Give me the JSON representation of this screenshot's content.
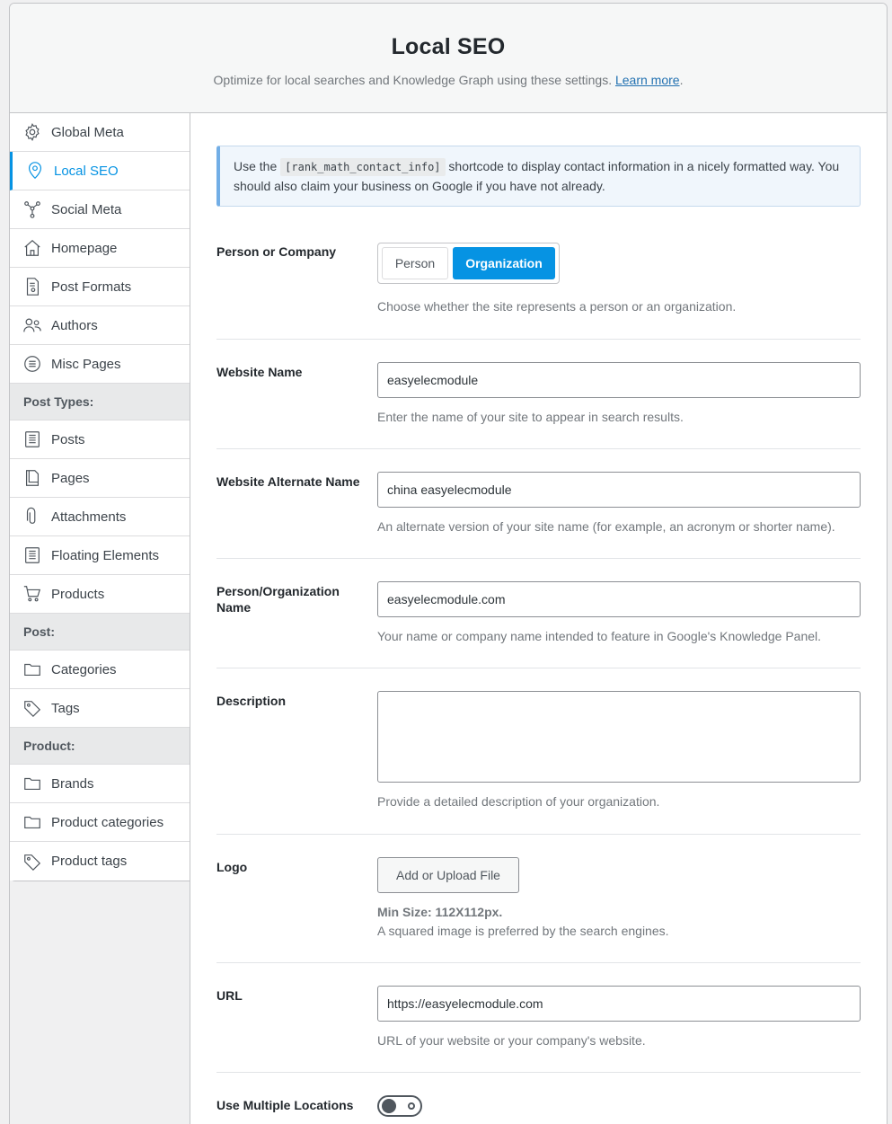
{
  "header": {
    "title": "Local SEO",
    "subtitle": "Optimize for local searches and Knowledge Graph using these settings.",
    "learn_more": "Learn more",
    "period": "."
  },
  "sidebar": {
    "items": [
      {
        "label": "Global Meta",
        "icon": "gear-icon"
      },
      {
        "label": "Local SEO",
        "icon": "location-pin-icon",
        "active": true
      },
      {
        "label": "Social Meta",
        "icon": "share-nodes-icon"
      },
      {
        "label": "Homepage",
        "icon": "home-icon"
      },
      {
        "label": "Post Formats",
        "icon": "post-format-icon"
      },
      {
        "label": "Authors",
        "icon": "users-icon"
      },
      {
        "label": "Misc Pages",
        "icon": "list-circle-icon"
      }
    ],
    "group_post_types": "Post Types:",
    "post_types": [
      {
        "label": "Posts",
        "icon": "document-icon"
      },
      {
        "label": "Pages",
        "icon": "pages-icon"
      },
      {
        "label": "Attachments",
        "icon": "paperclip-icon"
      },
      {
        "label": "Floating Elements",
        "icon": "document-icon"
      },
      {
        "label": "Products",
        "icon": "cart-icon"
      }
    ],
    "group_post": "Post:",
    "post": [
      {
        "label": "Categories",
        "icon": "folder-icon"
      },
      {
        "label": "Tags",
        "icon": "tag-icon"
      }
    ],
    "group_product": "Product:",
    "product": [
      {
        "label": "Brands",
        "icon": "folder-icon"
      },
      {
        "label": "Product categories",
        "icon": "folder-icon"
      },
      {
        "label": "Product tags",
        "icon": "tag-icon"
      }
    ]
  },
  "notice": {
    "before": "Use the ",
    "code": "[rank_math_contact_info]",
    "after": " shortcode to display contact information in a nicely formatted way. You should also claim your business on Google if you have not already."
  },
  "fields": {
    "person_company": {
      "label": "Person or Company",
      "option_person": "Person",
      "option_org": "Organization",
      "selected": "Organization",
      "desc": "Choose whether the site represents a person or an organization."
    },
    "website_name": {
      "label": "Website Name",
      "value": "easyelecmodule",
      "desc": "Enter the name of your site to appear in search results."
    },
    "alt_name": {
      "label": "Website Alternate Name",
      "value": "china easyelecmodule",
      "desc": "An alternate version of your site name (for example, an acronym or shorter name)."
    },
    "org_name": {
      "label": "Person/Organization Name",
      "value": "easyelecmodule.com",
      "desc": "Your name or company name intended to feature in Google's Knowledge Panel."
    },
    "description": {
      "label": "Description",
      "value": "",
      "desc": "Provide a detailed description of your organization."
    },
    "logo": {
      "label": "Logo",
      "button": "Add or Upload File",
      "min_size": "Min Size: 112X112px.",
      "desc": "A squared image is preferred by the search engines."
    },
    "url": {
      "label": "URL",
      "value": "https://easyelecmodule.com",
      "desc": "URL of your website or your company's website."
    },
    "multiple_locations": {
      "label": "Use Multiple Locations",
      "enabled": false
    }
  },
  "colors": {
    "accent": "#0693e3",
    "notice_border": "#72aee6"
  }
}
